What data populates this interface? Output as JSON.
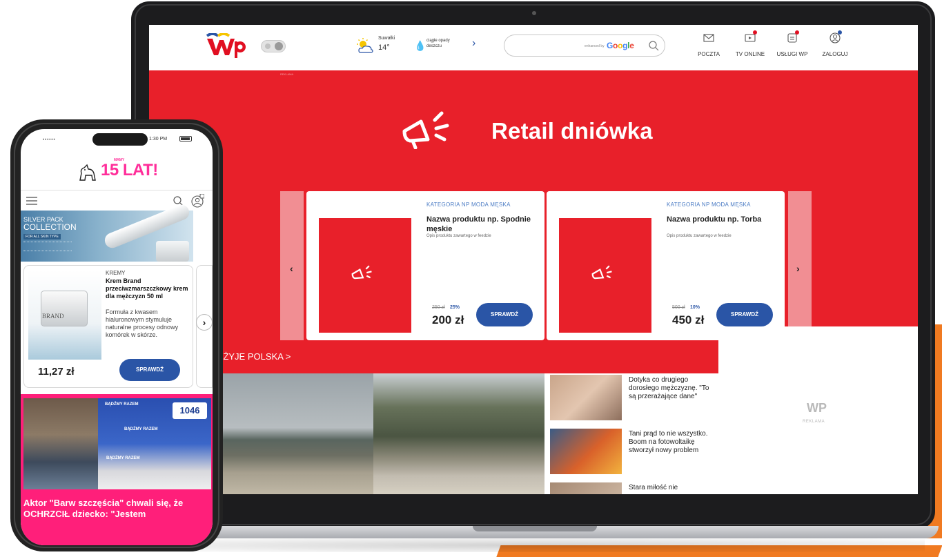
{
  "laptop": {
    "header": {
      "logo": "WP",
      "weather": {
        "city": "Suwałki",
        "temp": "14°",
        "forecast": "ciągłe opady deszczu"
      },
      "search": {
        "enhanced_by": "enhanced by",
        "google": "Google"
      },
      "nav": [
        {
          "label": "POCZTA",
          "icon": "mail-icon"
        },
        {
          "label": "TV ONLINE",
          "icon": "tv-icon"
        },
        {
          "label": "USŁUGI WP",
          "icon": "services-icon"
        },
        {
          "label": "ZALOGUJ",
          "icon": "user-icon"
        }
      ]
    },
    "ad_label": "REKLAMA",
    "retail": {
      "title": "Retail dniówka",
      "products": [
        {
          "category": "KATEGORIA NP MODA MĘSKA",
          "name": "Nazwa produktu np. Spodnie męskie",
          "desc": "Opis produktu zawartego w feedzie",
          "old_price": "250 zł",
          "discount": "25%",
          "price": "200 zł",
          "cta": "SPRAWDŹ"
        },
        {
          "category": "KATEGORIA NP MODA MĘSKA",
          "name": "Nazwa produktu np. Torba",
          "desc": "Opis produktu zawartego w feedzie",
          "old_price": "500 zł",
          "discount": "10%",
          "price": "450 zł",
          "cta": "SPRAWDŹ"
        }
      ],
      "prev": "‹",
      "next": "›"
    },
    "news": {
      "section": "M ŻYJE POLSKA >",
      "items": [
        {
          "text": "Dotyka co drugiego dorosłego mężczyznę. \"To są przerażające dane\""
        },
        {
          "text": "Tani prąd to nie wszystko. Boom na fotowoltaikę stworzył nowy problem"
        },
        {
          "text": "Stara miłość nie"
        }
      ]
    },
    "side_ad": {
      "logo": "WP",
      "label": "REKLAMA"
    }
  },
  "phone": {
    "status": {
      "signal": "••••••",
      "time": "1:30 PM"
    },
    "logo": {
      "main": "15 LAT!",
      "small": "MAMY"
    },
    "banner": {
      "line1": "SILVER PACK",
      "line2": "COLLECTION",
      "tag": "FOR ALL SKIN TYPE"
    },
    "product": {
      "category": "KREMY",
      "name": "Krem Brand przeciwzmarszczkowy krem dla mężczyzn 50 ml",
      "desc": "Formuła z kwasem hialuronowym stymuluje naturalne procesy odnowy komórek w skórze.",
      "jar_label": "BRAND",
      "price": "11,27 zł",
      "cta": "SPRAWDŹ",
      "next": "›"
    },
    "article": {
      "badge": "1046",
      "razem": "BĄDŹMY RAZEM",
      "title": "Aktor \"Barw szczęścia\" chwali się, że OCHRZCIŁ dziecko: \"Jestem"
    }
  },
  "colors": {
    "brand_red": "#e8202a",
    "brand_blue": "#2a55a6",
    "pink": "#ff1f7a",
    "orange": "#f07a21"
  }
}
